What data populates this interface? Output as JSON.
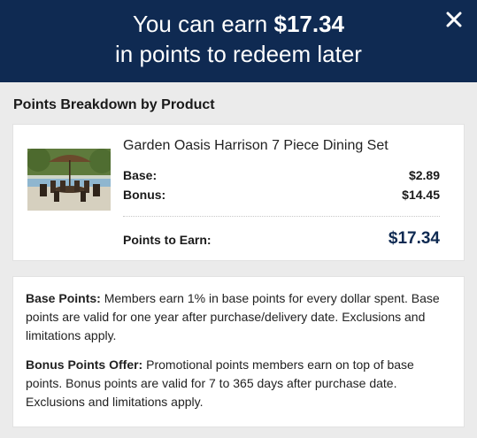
{
  "header": {
    "earn_prefix": "You can earn ",
    "earn_amount": "$17.34",
    "subtitle": "in points to redeem later",
    "close_icon": "close-icon"
  },
  "breakdown": {
    "title": "Points Breakdown by Product",
    "product": {
      "name": "Garden Oasis Harrison 7 Piece Dining Set",
      "image": "patio-dining-set-thumbnail",
      "base_label": "Base:",
      "base_value": "$2.89",
      "bonus_label": "Bonus:",
      "bonus_value": "$14.45",
      "total_label": "Points to Earn:",
      "total_value": "$17.34"
    }
  },
  "info": {
    "base_title": "Base Points:",
    "base_text": " Members earn 1% in base points for every dollar spent. Base points are valid for one year after purchase/delivery date. Exclusions and limitations apply.",
    "bonus_title": "Bonus Points Offer:",
    "bonus_text": " Promotional points members earn on top of base points. Bonus points are valid for 7 to 365 days after purchase date. Exclusions and limitations apply."
  },
  "colors": {
    "header_bg": "#0f2a52",
    "page_bg": "#ebebeb",
    "total_accent": "#0f2a52"
  }
}
